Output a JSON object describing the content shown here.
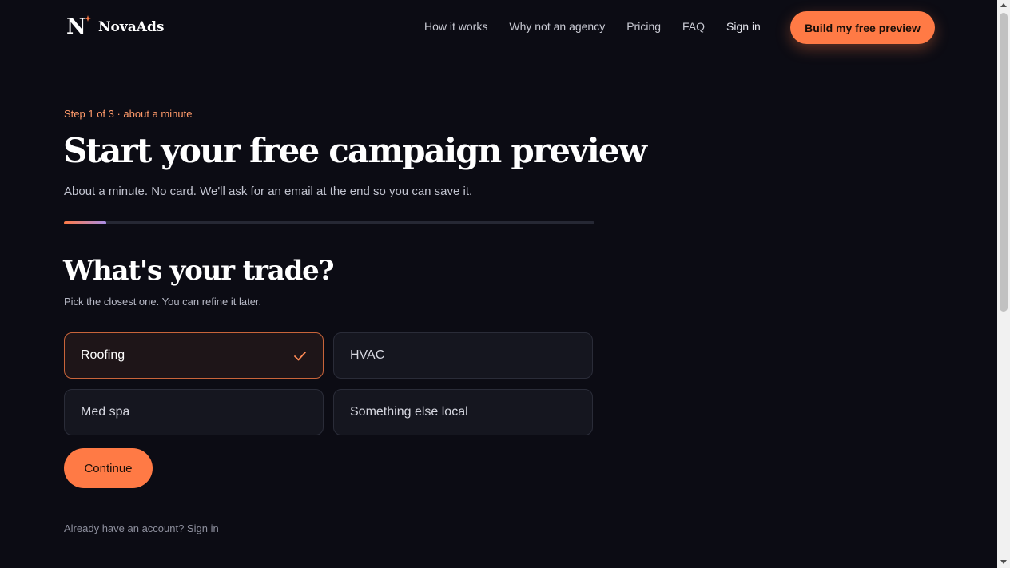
{
  "header": {
    "logo_letter": "N",
    "brand": "NovaAds",
    "nav": [
      "How it works",
      "Why not an agency",
      "Pricing",
      "FAQ",
      "Sign in"
    ],
    "cta": "Build my free preview"
  },
  "main": {
    "step": "Step 1 of 3 · about a minute",
    "title": "Start your free campaign preview",
    "subtitle": "About a minute. No card. We'll ask for an email at the end so you can save it.",
    "progress": 0.08,
    "question": "What's your trade?",
    "hint": "Pick the closest one. You can refine it later.",
    "options": [
      "Roofing",
      "HVAC",
      "Med spa",
      "Something else local"
    ],
    "selected_option": "Roofing",
    "continue_label": "Continue",
    "account_text": "Already have an account? Sign in"
  },
  "colors": {
    "background": "#0c0c14",
    "accent": "#ff7a45",
    "card": "#15161f"
  },
  "icons": {
    "logo": "sparkle-icon",
    "selected": "check-icon"
  }
}
